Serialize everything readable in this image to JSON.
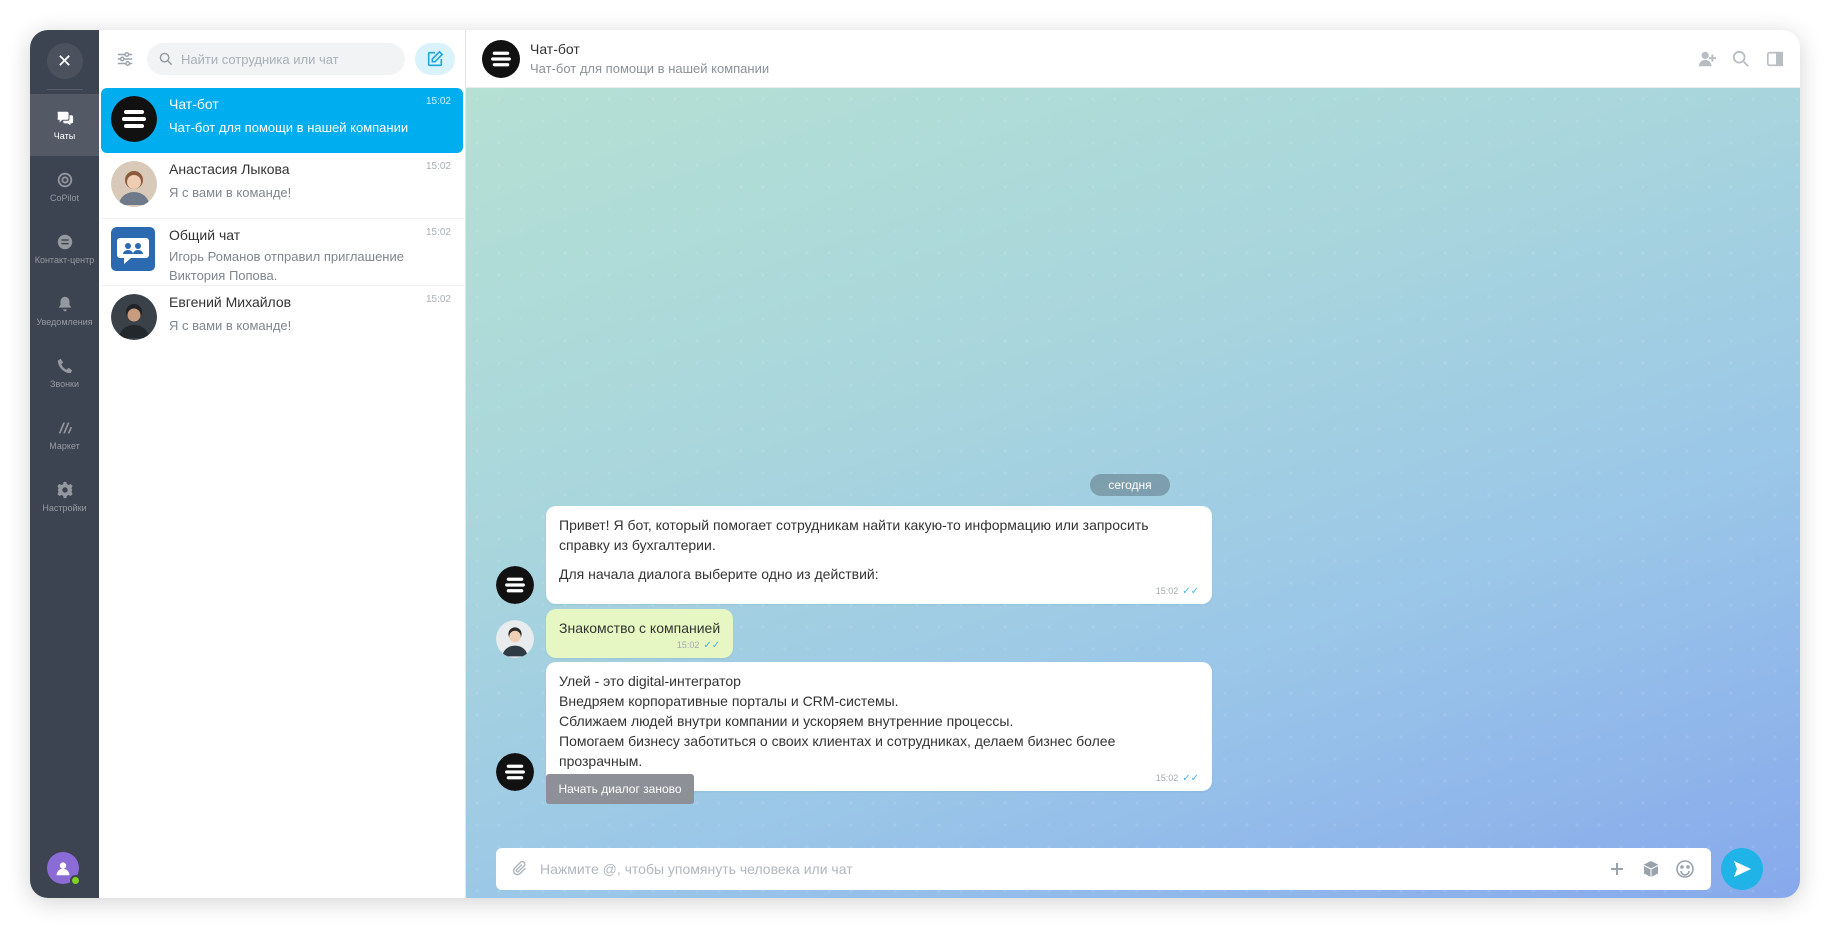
{
  "rail": {
    "items": [
      {
        "label": "Чаты",
        "icon": "chats-icon",
        "active": true
      },
      {
        "label": "CoPilot",
        "icon": "copilot-icon",
        "active": false
      },
      {
        "label": "Контакт-центр",
        "icon": "contact-center-icon",
        "active": false
      },
      {
        "label": "Уведомления",
        "icon": "bell-icon",
        "active": false
      },
      {
        "label": "Звонки",
        "icon": "phone-icon",
        "active": false
      },
      {
        "label": "Маркет",
        "icon": "market-icon",
        "active": false
      },
      {
        "label": "Настройки",
        "icon": "gear-icon",
        "active": false
      }
    ]
  },
  "search": {
    "placeholder": "Найти сотрудника или чат"
  },
  "chats": [
    {
      "name": "Чат-бот",
      "preview": "Чат-бот для помощи в нашей компании",
      "time": "15:02",
      "active": true
    },
    {
      "name": "Анастасия Лыкова",
      "preview": "Я с вами в команде!",
      "time": "15:02",
      "active": false
    },
    {
      "name": "Общий чат",
      "preview": "Игорь Романов отправил приглашение Виктория Попова.",
      "time": "15:02",
      "active": false
    },
    {
      "name": "Евгений Михайлов",
      "preview": "Я с вами в команде!",
      "time": "15:02",
      "active": false
    }
  ],
  "header": {
    "title": "Чат-бот",
    "subtitle": "Чат-бот для помощи в нашей компании"
  },
  "date_divider": "сегодня",
  "messages": [
    {
      "author": "bot",
      "paragraphs": [
        "Привет! Я бот, который помогает сотрудникам найти какую-то информацию или запросить справку из бухгалтерии.",
        "Для начала диалога выберите одно из действий:"
      ],
      "time": "15:02"
    },
    {
      "author": "me",
      "paragraphs": [
        "Знакомство с компанией"
      ],
      "time": "15:02"
    },
    {
      "author": "bot",
      "lines": [
        "Улей - это digital-интегратор",
        "Внедряем корпоративные порталы и CRM-системы.",
        "Сближаем людей внутри компании и ускоряем внутренние процессы.",
        "Помогаем бизнесу заботиться о своих клиентах и сотрудниках, делаем бизнес более прозрачным."
      ],
      "time": "15:02"
    }
  ],
  "restart_button": "Начать диалог заново",
  "composer": {
    "placeholder": "Нажмите @, чтобы упомянуть человека или чат"
  },
  "colors": {
    "accent": "#00aeef",
    "rail": "#3c4451",
    "my_bubble": "#e6f7c3"
  }
}
